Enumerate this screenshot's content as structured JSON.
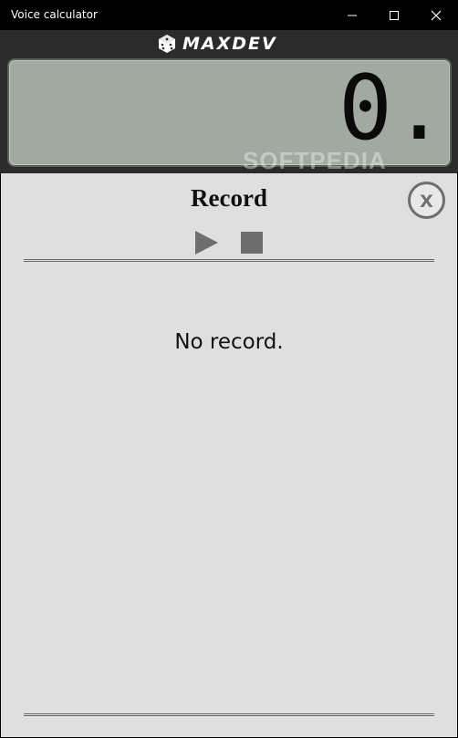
{
  "window": {
    "title": "Voice calculator",
    "minimize_icon": "minimize-icon",
    "maximize_icon": "maximize-icon",
    "close_icon": "close-icon"
  },
  "header": {
    "brand": "MAXDEV",
    "brand_icon": "dice-icon",
    "display_value": "0.",
    "watermark": "SOFTPEDIA"
  },
  "record_panel": {
    "title": "Record",
    "close_label": "x",
    "play_icon": "play-icon",
    "stop_icon": "stop-icon",
    "empty_message": "No record."
  },
  "colors": {
    "title_bar": "#000000",
    "header_bg": "#2b2b2b",
    "lcd_bg": "#a0aaa0",
    "panel_bg": "#dfdfdf",
    "control_gray": "#6e6e6e"
  }
}
